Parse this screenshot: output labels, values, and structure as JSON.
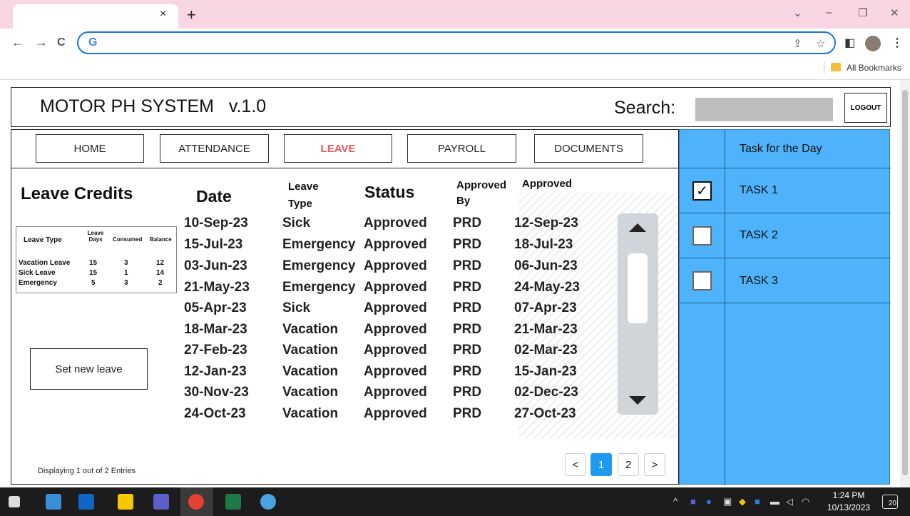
{
  "browser": {
    "tab_close": "×",
    "new_tab": "+",
    "window_controls": [
      "⌄",
      "–",
      "❐",
      "✕"
    ],
    "nav_icons": [
      "←",
      "→",
      "C"
    ],
    "omnibox_logo": "G",
    "omnibox_icons": [
      "⇪",
      "☆"
    ],
    "toolbar_icons": [
      "◧",
      "⋮"
    ],
    "bookmarks_label": "All Bookmarks"
  },
  "header": {
    "title": "MOTOR PH SYSTEM   v.1.0",
    "search_label": "Search:",
    "search_value": "",
    "logout_label": "LOGOUT"
  },
  "nav": {
    "items": [
      {
        "label": "HOME",
        "active": false
      },
      {
        "label": "ATTENDANCE",
        "active": false
      },
      {
        "label": "LEAVE",
        "active": true
      },
      {
        "label": "PAYROLL",
        "active": false
      },
      {
        "label": "DOCUMENTS",
        "active": false
      }
    ]
  },
  "leave_credits": {
    "title": "Leave Credits",
    "headers": {
      "leave_type": "Leave Type",
      "leave_days": "Leave Days",
      "consumed": "Consumed",
      "balance": "Balance"
    },
    "rows": [
      {
        "type": "Vacation Leave",
        "days": "15",
        "consumed": "3",
        "balance": "12"
      },
      {
        "type": "Sick Leave",
        "days": "15",
        "consumed": "1",
        "balance": "14"
      },
      {
        "type": "Emergency",
        "days": "5",
        "consumed": "3",
        "balance": "2"
      }
    ]
  },
  "set_leave_label": "Set new leave",
  "entries_text": "Displaying 1 out of 2 Entries",
  "leave_table": {
    "headers": {
      "date": "Date",
      "leave_type": "Leave Type",
      "status": "Status",
      "approved_by": "Approved By",
      "approved_date": "Approved Date"
    },
    "rows": [
      {
        "date": "10-Sep-23",
        "type": "Sick",
        "status": "Approved",
        "by": "PRD",
        "approved": "12-Sep-23"
      },
      {
        "date": "15-Jul-23",
        "type": "Emergency",
        "status": "Approved",
        "by": "PRD",
        "approved": "18-Jul-23"
      },
      {
        "date": "03-Jun-23",
        "type": "Emergency",
        "status": "Approved",
        "by": "PRD",
        "approved": "06-Jun-23"
      },
      {
        "date": "21-May-23",
        "type": "Emergency",
        "status": "Approved",
        "by": "PRD",
        "approved": "24-May-23"
      },
      {
        "date": "05-Apr-23",
        "type": "Sick",
        "status": "Approved",
        "by": "PRD",
        "approved": "07-Apr-23"
      },
      {
        "date": "18-Mar-23",
        "type": "Vacation",
        "status": "Approved",
        "by": "PRD",
        "approved": "21-Mar-23"
      },
      {
        "date": "27-Feb-23",
        "type": "Vacation",
        "status": "Approved",
        "by": "PRD",
        "approved": "02-Mar-23"
      },
      {
        "date": "12-Jan-23",
        "type": "Vacation",
        "status": "Approved",
        "by": "PRD",
        "approved": "15-Jan-23"
      },
      {
        "date": "30-Nov-23",
        "type": "Vacation",
        "status": "Approved",
        "by": "PRD",
        "approved": "02-Dec-23"
      },
      {
        "date": "24-Oct-23",
        "type": "Vacation",
        "status": "Approved",
        "by": "PRD",
        "approved": "27-Oct-23"
      }
    ]
  },
  "pagination": {
    "prev": "<",
    "pages": [
      "1",
      "2"
    ],
    "current": "1",
    "next": ">"
  },
  "tasks": {
    "title": "Task for the Day",
    "items": [
      {
        "label": "TASK 1",
        "checked": true
      },
      {
        "label": "TASK 2",
        "checked": false
      },
      {
        "label": "TASK 3",
        "checked": false
      }
    ]
  },
  "taskbar": {
    "time": "1:24 PM",
    "date": "10/13/2023",
    "notifications": "20"
  },
  "colors": {
    "tab_strip": "#f9d6e3",
    "active_nav": "#e95a5a",
    "task_panel": "#4fb3fb",
    "pagination_active": "#1e9bf0",
    "search_box": "#bdbdbd"
  }
}
